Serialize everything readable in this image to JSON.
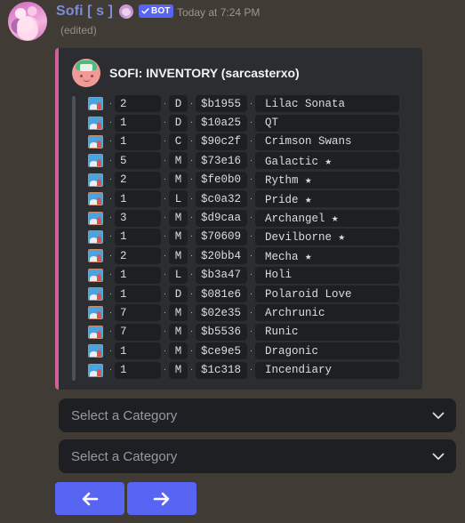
{
  "message": {
    "username": "Sofi [ s ]",
    "bot_label": "BOT",
    "timestamp": "Today at 7:24 PM",
    "edited_label": "(edited)",
    "avatar_icon": "user-avatar",
    "mini_avatar_icon": "decoration-avatar",
    "verified_icon": "check-icon"
  },
  "embed": {
    "border_color": "#d4609b",
    "background": "#2b2d31",
    "author_icon": "elf-avatar-icon",
    "author_name": "SOFI: INVENTORY (sarcasterxo)",
    "separator": "·",
    "item_icon": "framed-picture-icon",
    "items": [
      {
        "count": "2",
        "rank": "D",
        "code": "$b1955",
        "name": "Lilac Sonata"
      },
      {
        "count": "1",
        "rank": "D",
        "code": "$10a25",
        "name": "QT"
      },
      {
        "count": "1",
        "rank": "C",
        "code": "$90c2f",
        "name": "Crimson Swans"
      },
      {
        "count": "5",
        "rank": "M",
        "code": "$73e16",
        "name": "Galactic ★"
      },
      {
        "count": "2",
        "rank": "M",
        "code": "$fe0b0",
        "name": "Rythm ★"
      },
      {
        "count": "1",
        "rank": "L",
        "code": "$c0a32",
        "name": "Pride ★"
      },
      {
        "count": "3",
        "rank": "M",
        "code": "$d9caa",
        "name": "Archangel ★"
      },
      {
        "count": "1",
        "rank": "M",
        "code": "$70609",
        "name": "Devilborne ★"
      },
      {
        "count": "2",
        "rank": "M",
        "code": "$20bb4",
        "name": "Mecha ★"
      },
      {
        "count": "1",
        "rank": "L",
        "code": "$b3a47",
        "name": "Holi"
      },
      {
        "count": "1",
        "rank": "D",
        "code": "$081e6",
        "name": "Polaroid Love"
      },
      {
        "count": "7",
        "rank": "M",
        "code": "$02e35",
        "name": "Archrunic"
      },
      {
        "count": "7",
        "rank": "M",
        "code": "$b5536",
        "name": "Runic"
      },
      {
        "count": "1",
        "rank": "M",
        "code": "$ce9e5",
        "name": "Dragonic"
      },
      {
        "count": "1",
        "rank": "M",
        "code": "$1c318",
        "name": "Incendiary"
      }
    ]
  },
  "components": {
    "select_1": {
      "label": "Select a Category",
      "icon": "chevron-down-icon"
    },
    "select_2": {
      "label": "Select a Category",
      "icon": "chevron-down-icon"
    },
    "prev_button": {
      "icon": "arrow-left-icon",
      "color": "#5865f2"
    },
    "next_button": {
      "icon": "arrow-right-icon",
      "color": "#5865f2"
    }
  }
}
